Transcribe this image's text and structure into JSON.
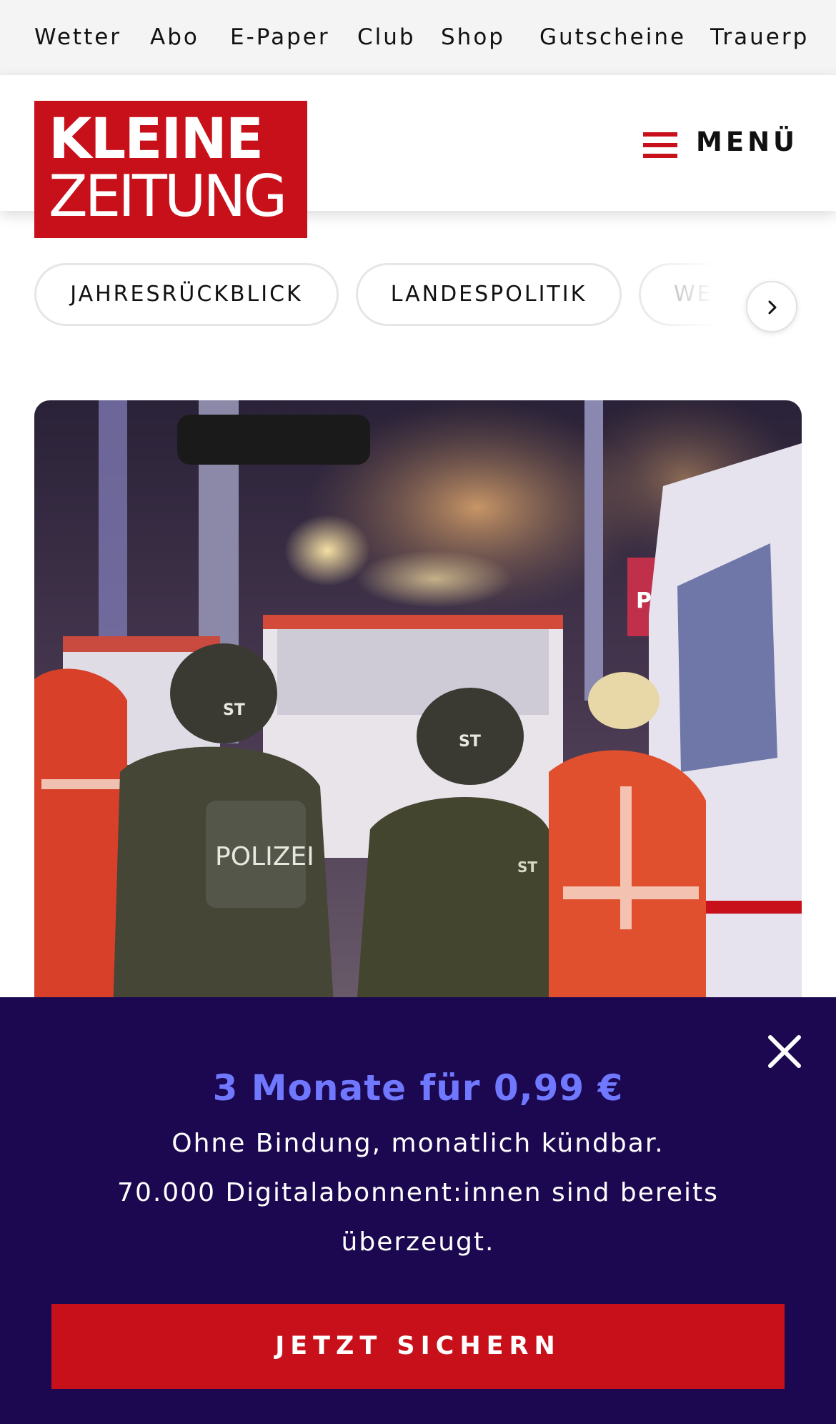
{
  "utility_nav": [
    "Wetter",
    "Abo",
    "E-Paper",
    "Club",
    "Shop",
    "Gutscheine",
    "Trauerp"
  ],
  "logo": {
    "line1": "KLEINE",
    "line2": "ZEITUNG"
  },
  "header": {
    "menu_label": "MENÜ"
  },
  "topics": [
    "JAHRESRÜCKBLICK",
    "LANDESPOLITIK",
    "WE"
  ],
  "hero": {
    "image_text": [
      "POLIZEI",
      "ST",
      "ST",
      "ST",
      "Presse"
    ]
  },
  "offer": {
    "headline": "3 Monate für 0,99 €",
    "line1": "Ohne Bindung, monatlich kündbar.",
    "line2": "70.000 Digitalabonnent:innen sind bereits",
    "line3": "überzeugt.",
    "cta_label": "JETZT SICHERN"
  },
  "colors": {
    "brand_red": "#c8101a",
    "offer_bg": "#1c0850",
    "offer_headline": "#6f78ff"
  },
  "icons": {
    "menu": "hamburger-icon",
    "next": "chevron-right-icon",
    "close": "close-icon"
  }
}
